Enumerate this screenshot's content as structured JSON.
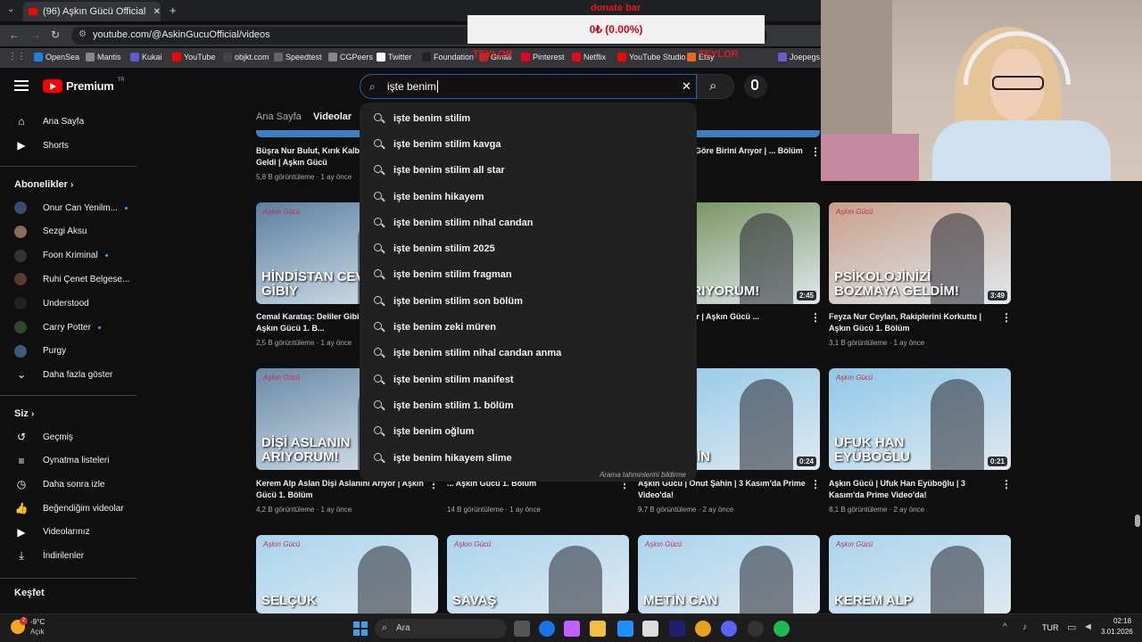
{
  "browser": {
    "tab_title": "(96) Aşkın Gücü Official - YouTube",
    "url": "youtube.com/@AskinGucuOfficial/videos",
    "bookmarks": [
      "OpenSea",
      "Mantis",
      "Kukai",
      "YouTube",
      "objkt.com",
      "Speedtest",
      "CGPeers",
      "Twitter",
      "Foundation",
      "Gmail",
      "Pinterest",
      "Netflix",
      "YouTube Studio",
      "Etsy",
      "Joepegs"
    ]
  },
  "overlay": {
    "donation_title": "donate bar",
    "donation_amount": "0₺ (0.00%)",
    "goal_left": "TEYLOR",
    "goal_right": "TEYLOR"
  },
  "youtube": {
    "logo": "Premium",
    "logo_region": "TR",
    "search": {
      "value": "işte benim",
      "suggestions": [
        "işte benim stilim",
        "işte benim stilim kavga",
        "işte benim stilim all star",
        "işte benim hikayem",
        "işte benim stilim nihal candan",
        "işte benim stilim 2025",
        "işte benim stilim fragman",
        "işte benim stilim son bölüm",
        "işte benim zeki müren",
        "işte benim stilim nihal candan anma",
        "işte benim stilim manifest",
        "işte benim stilim 1. bölüm",
        "işte benim oğlum",
        "işte benim hikayem slime"
      ],
      "report_label": "Arama tahminlerini bildirme"
    },
    "channel_tabs": [
      "Ana Sayfa",
      "Videolar"
    ],
    "sidebar": {
      "home": "Ana Sayfa",
      "shorts": "Shorts",
      "subs_header": "Abonelikler",
      "subscriptions": [
        {
          "name": "Onur Can Yenilm...",
          "dot": true,
          "color": "#3b4a6b"
        },
        {
          "name": "Sezgi Aksu",
          "dot": false,
          "color": "#8a6a5a"
        },
        {
          "name": "Foon Kriminal",
          "dot": true,
          "color": "#333333"
        },
        {
          "name": "Ruhi Çenet Belgese...",
          "dot": false,
          "color": "#5a3a2a"
        },
        {
          "name": "Understood",
          "dot": false,
          "color": "#222222"
        },
        {
          "name": "Carry Potter",
          "dot": true,
          "color": "#2a4a2a"
        },
        {
          "name": "Purgy",
          "dot": false,
          "color": "#3a5a7a"
        }
      ],
      "show_more": "Daha fazla göster",
      "you_header": "Siz",
      "you_items": [
        "Geçmiş",
        "Oynatma listeleri",
        "Daha sonra izle",
        "Beğendiğim videolar",
        "Videolarınız",
        "İndirilenler"
      ],
      "explore_header": "Keşfet"
    },
    "videos_row1": [
      {
        "title": "Büşra Nur Bulut, Kırık Kalbini Bulmaya Geldi | Aşkın Gücü",
        "meta": "5,8 B görüntüleme · 1 ay önce"
      },
      {
        "title": "...oğlu Kalbine Göre Birini Arıyor | ... Bölüm",
        "meta": "· 1 ay önce"
      }
    ],
    "videos_row2": [
      {
        "thumb_text": "HİNDİSTAN CEVİZİ GİBİY",
        "title": "Cemal Karataş: Deliler Gibi A... İstiyorum | Aşkın Gücü 1. B...",
        "meta": "2,5 B görüntüleme · 1 ay önce",
        "duration": "",
        "bg": "#5b7fa0"
      },
      {
        "thumb_text": "...MIN ARIYORUM!",
        "title": "...r Aşkını Arıyor | Aşkın Gücü ...",
        "meta": "· 1 ay önce",
        "duration": "2:45",
        "bg": "#6d8a4f"
      },
      {
        "thumb_text": "PSİKOLOJİNİZİ BOZMAYA GELDİM!",
        "title": "Feyza Nur Ceylan, Rakiplerini Korkuttu | Aşkın Gücü 1. Bölüm",
        "meta": "3,1 B görüntüleme · 1 ay önce",
        "duration": "3:49",
        "bg": "#c9a08a"
      }
    ],
    "videos_row3": [
      {
        "thumb_text": "DİŞİ ASLANIN ARIYORUM!",
        "title": "Kerem Alp Aslan Dişi Aslanını Arıyor | Aşkın Gücü 1. Bölüm",
        "meta": "4,2 B görüntüleme · 1 ay önce",
        "duration": "",
        "bg": "#6a8aa8"
      },
      {
        "thumb_text": "",
        "title": "... Aşkın Gücü 1. Bölüm",
        "meta": "14 B görüntüleme · 1 ay önce",
        "duration": "",
        "bg": "#8aa0b8"
      },
      {
        "thumb_text": "...UT ...HİN",
        "title": "Aşkın Gücü | Onut Şahin | 3 Kasım'da Prime Video'da!",
        "meta": "9,7 B görüntüleme · 2 ay önce",
        "duration": "0:24",
        "bg": "#8fc8e8"
      },
      {
        "thumb_text": "UFUK HAN EYÜBOĞLU",
        "title": "Aşkın Gücü | Ufuk Han Eyüboğlu | 3 Kasım'da Prime Video'da!",
        "meta": "8,1 B görüntüleme · 2 ay önce",
        "duration": "0:21",
        "bg": "#8fc8e8"
      }
    ],
    "videos_row4": [
      {
        "thumb_text": "SELÇUK",
        "bg": "#a8d4ee"
      },
      {
        "thumb_text": "SAVAŞ",
        "bg": "#a8d4ee"
      },
      {
        "thumb_text": "METİN CAN",
        "bg": "#a8d4ee"
      },
      {
        "thumb_text": "KEREM ALP",
        "bg": "#a8d4ee"
      }
    ],
    "thumb_brand": "Aşkın Gücü"
  },
  "taskbar": {
    "weather_temp": "-9°C",
    "weather_desc": "Açık",
    "weather_badge": "2",
    "search_placeholder": "Ara",
    "lang": "TUR",
    "time": "02:18",
    "date": "3.01.2026"
  },
  "colors": {
    "accent": "#3ea6ff",
    "youtube_red": "#ff0000",
    "bg": "#0f0f0f"
  }
}
